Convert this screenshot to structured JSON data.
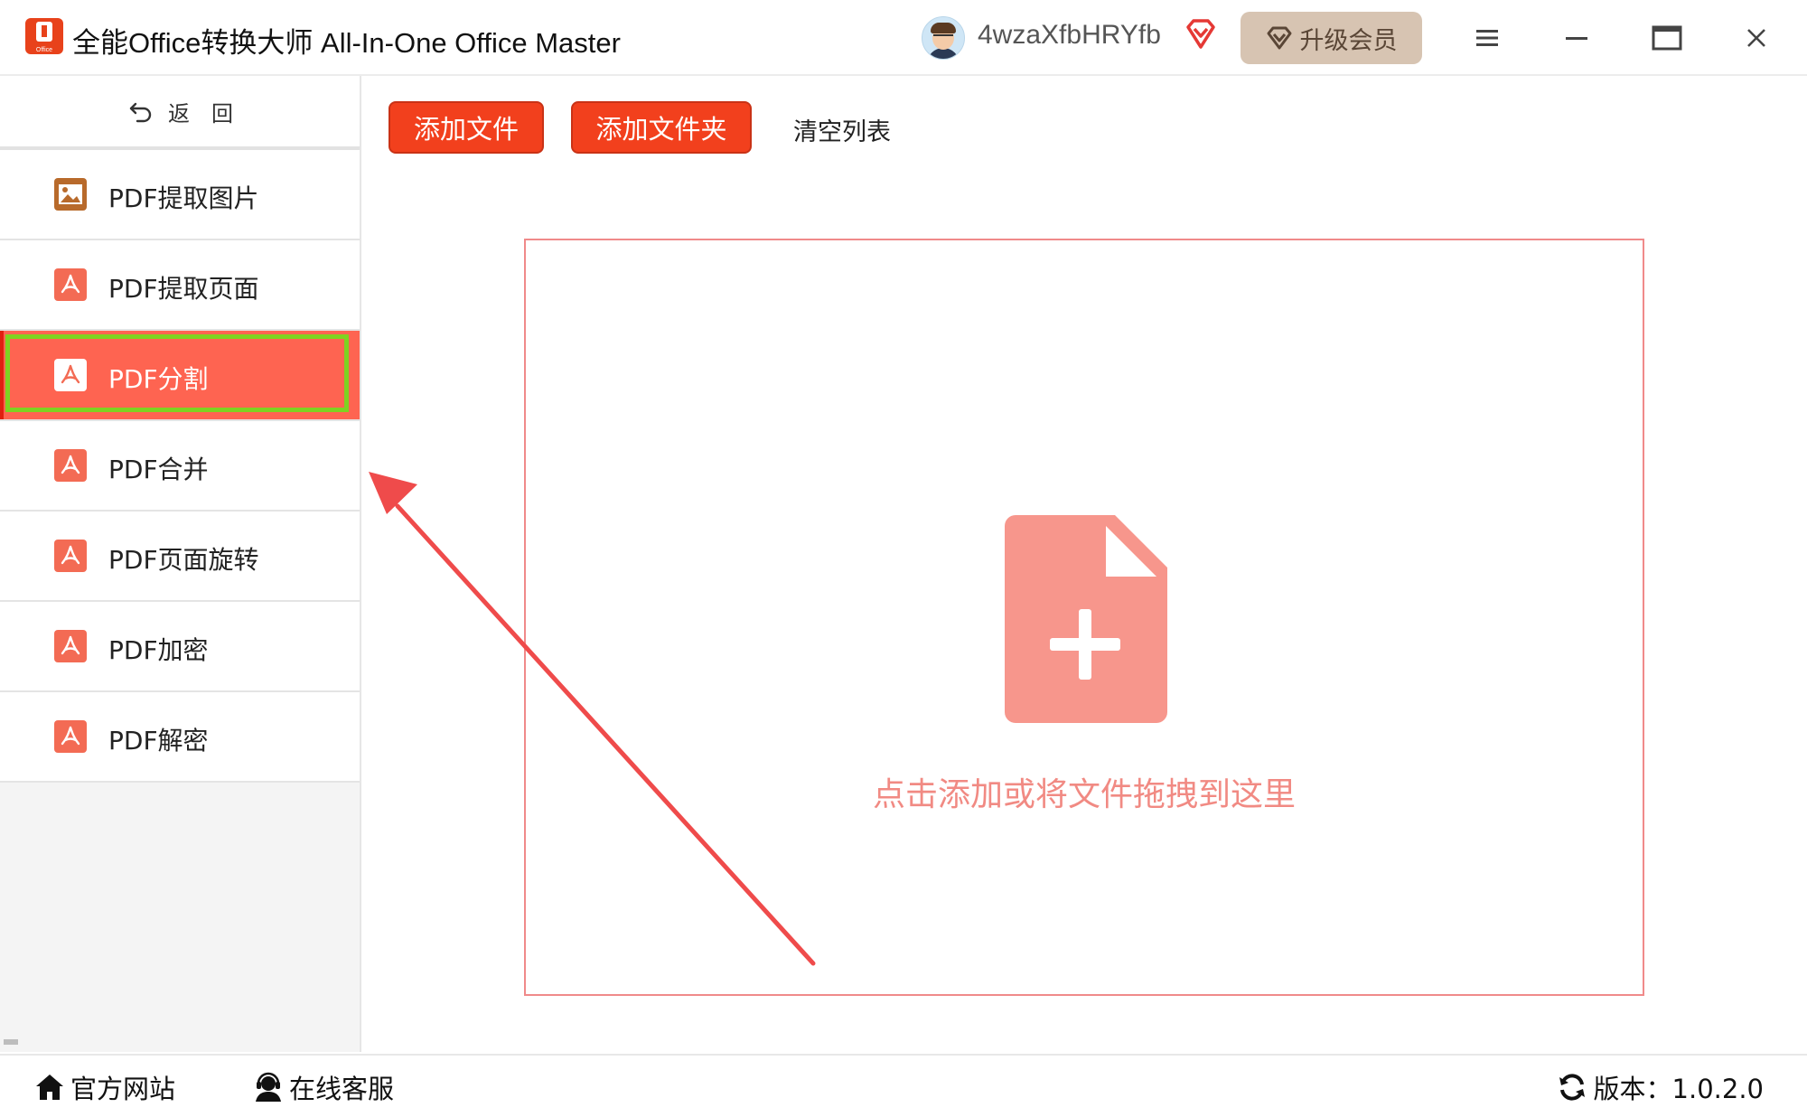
{
  "window": {
    "title": "全能Office转换大师 All-In-One Office Master",
    "logo_text": "Office",
    "username": "4wzaXfbHRYfb",
    "upgrade_label": "升级会员"
  },
  "sidebar": {
    "back_label": "返　回",
    "items": [
      {
        "label": "PDF提取图片",
        "icon": "image-icon"
      },
      {
        "label": "PDF提取页面",
        "icon": "pdf-icon"
      },
      {
        "label": "PDF分割",
        "icon": "pdf-icon",
        "active": true
      },
      {
        "label": "PDF合并",
        "icon": "pdf-icon"
      },
      {
        "label": "PDF页面旋转",
        "icon": "pdf-icon"
      },
      {
        "label": "PDF加密",
        "icon": "pdf-icon"
      },
      {
        "label": "PDF解密",
        "icon": "pdf-icon"
      }
    ]
  },
  "toolbar": {
    "add_file_label": "添加文件",
    "add_folder_label": "添加文件夹",
    "clear_list_label": "清空列表"
  },
  "dropzone": {
    "hint": "点击添加或将文件拖拽到这里"
  },
  "statusbar": {
    "website_label": "官方网站",
    "support_label": "在线客服",
    "version_label": "版本：1.0.2.0"
  },
  "colors": {
    "accent": "#f2401d",
    "active_item": "#fe6451",
    "highlight_outline": "#7ed321",
    "annotation_arrow": "#ef4b4b",
    "dropzone_icon": "#f7968c"
  }
}
